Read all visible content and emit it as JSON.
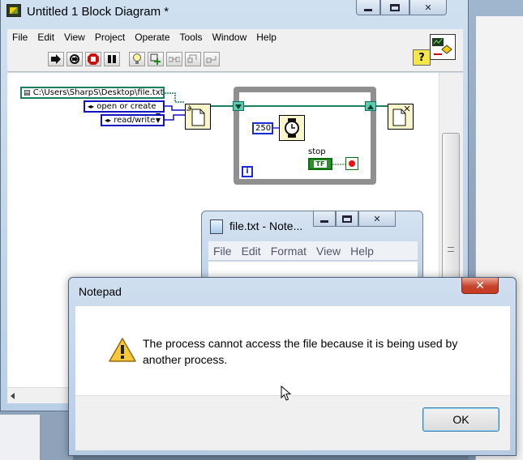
{
  "labview": {
    "title": "Untitled 1 Block Diagram *",
    "menu": [
      "File",
      "Edit",
      "View",
      "Project",
      "Operate",
      "Tools",
      "Window",
      "Help"
    ],
    "toolbar_icons": [
      "run-arrow-icon",
      "run-continuously-icon",
      "abort-icon",
      "pause-icon",
      "highlight-execution-icon",
      "retain-wire-values-icon",
      "step-into-icon",
      "step-over-icon",
      "step-out-icon",
      "context-help-icon"
    ],
    "help_label": "?",
    "diagram": {
      "path_constant": "C:\\Users\\SharpS\\Desktop\\file.txt",
      "operation_enum": "open or create",
      "access_enum": "read/write",
      "wait_ms": "250",
      "iteration_label": "i",
      "stop_label": "stop",
      "bool_text": "TF"
    }
  },
  "notepad": {
    "title": "file.txt - Note...",
    "menu": [
      "File",
      "Edit",
      "Format",
      "View",
      "Help"
    ]
  },
  "dialog": {
    "title": "Notepad",
    "message": "The process cannot access the file because it is being used by another process.",
    "ok_label": "OK",
    "close_glyph": "✕"
  }
}
